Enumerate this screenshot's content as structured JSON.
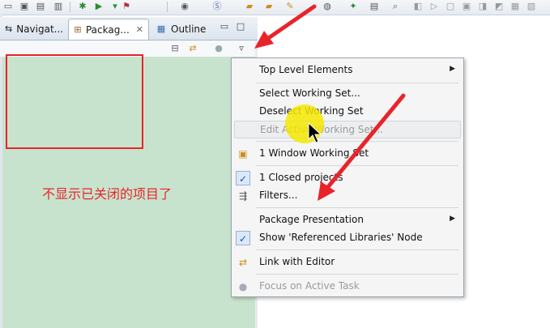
{
  "toolbar": {
    "icons": [
      "new-file-icon",
      "save-icon",
      "save-all-icon",
      "debug-icon",
      "run-icon",
      "external-tools-icon",
      "new-java-project-icon",
      "new-package-icon",
      "new-class-icon",
      "open-type-icon",
      "search-icon",
      "previous-annotation-icon",
      "next-annotation-icon",
      "back-icon",
      "forward-icon",
      "pin-icon",
      "console-icon",
      "terminate-icon"
    ]
  },
  "tabs": [
    {
      "label": "Navigat...",
      "active": false
    },
    {
      "label": "Packag...",
      "active": true
    },
    {
      "label": "Outline",
      "active": false
    }
  ],
  "view_toolbar": {
    "collapse_all_title": "Collapse All",
    "link_title": "Link with Editor",
    "focus_title": "Focus on Active Task",
    "menu_title": "View Menu"
  },
  "annotation": {
    "caption": "不显示已关闭的项目了",
    "highlight_color": "#e8242b"
  },
  "menu": {
    "items": [
      {
        "label": "Top Level Elements",
        "submenu": true
      },
      {
        "label": "Select Working Set..."
      },
      {
        "label": "Deselect Working Set"
      },
      {
        "label": "Edit Active Working Set...",
        "disabled": true
      },
      {
        "label": "1 Window Working Set"
      },
      {
        "label": "1 Closed projects",
        "checked": true
      },
      {
        "label": "Filters..."
      },
      {
        "label": "Package Presentation",
        "submenu": true
      },
      {
        "label": "Show 'Referenced Libraries' Node",
        "checked": true
      },
      {
        "label": "Link with Editor"
      },
      {
        "label": "Focus on Active Task",
        "disabled": true
      }
    ]
  },
  "colors": {
    "pane_background": "#c8e3cd",
    "accent_red": "#e8242b",
    "cursor_highlight": "#f4e800"
  }
}
